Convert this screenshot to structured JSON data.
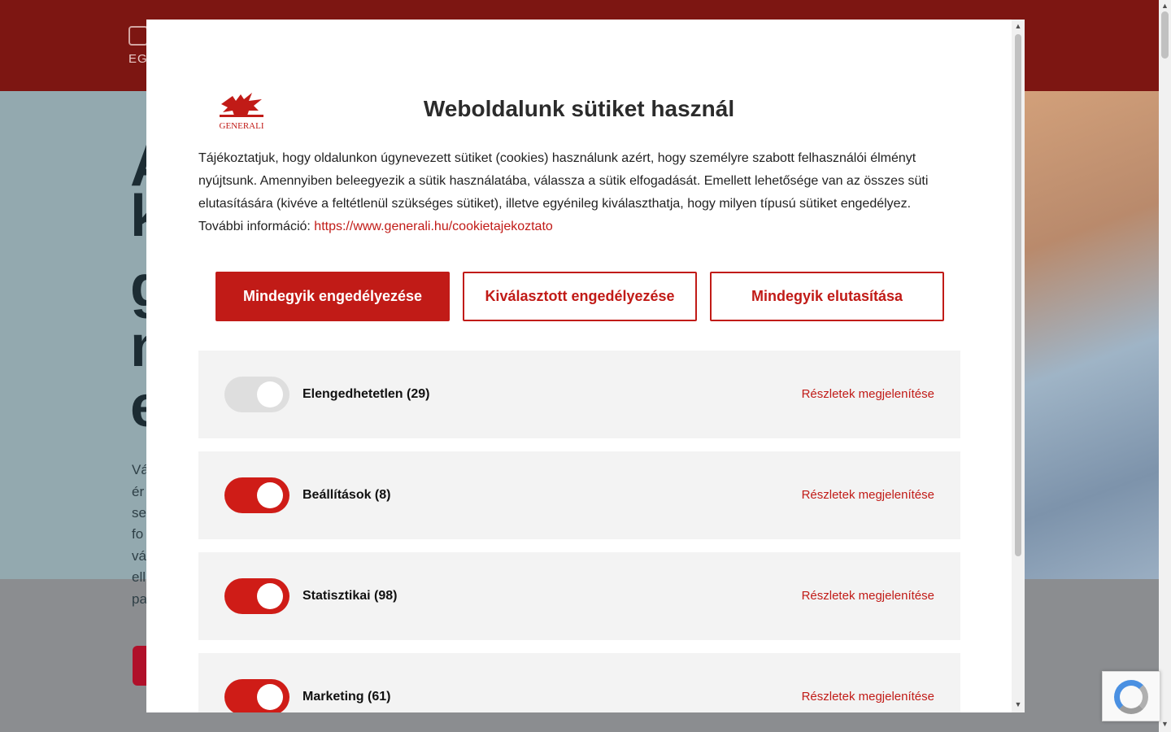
{
  "background": {
    "logo_text": "EGI",
    "hero_letters": [
      "A",
      "k",
      "g",
      "n",
      "e"
    ],
    "hero_lines": [
      "Vá",
      "ér",
      "se",
      "fo",
      "vá",
      "ell",
      "pa"
    ]
  },
  "modal": {
    "title": "Weboldalunk sütiket használ",
    "intro_text": "Tájékoztatjuk, hogy oldalunkon úgynevezett sütiket (cookies) használunk azért, hogy személyre szabott felhasználói élményt nyújtsunk. Amennyiben beleegyezik a sütik használatába, válassza a sütik elfogadását. Emellett lehetősége van az összes süti elutasítására (kivéve a feltétlenül szükséges sütiket), illetve egyénileg kiválaszthatja, hogy milyen típusú sütiket engedélyez. További információ: ",
    "intro_link": "https://www.generali.hu/cookietajekoztato",
    "logo_text": "GENERALI",
    "buttons": {
      "allow_all": "Mindegyik engedélyezése",
      "allow_selected": "Kiválasztott engedélyezése",
      "reject_all": "Mindegyik elutasítása"
    },
    "categories": [
      {
        "label": "Elengedhetetlen (29)",
        "details": "Részletek megjelenítése",
        "enabled": true,
        "locked": true
      },
      {
        "label": "Beállítások (8)",
        "details": "Részletek megjelenítése",
        "enabled": true,
        "locked": false
      },
      {
        "label": "Statisztikai (98)",
        "details": "Részletek megjelenítése",
        "enabled": true,
        "locked": false
      },
      {
        "label": "Marketing (61)",
        "details": "Részletek megjelenítése",
        "enabled": true,
        "locked": false
      }
    ]
  },
  "colors": {
    "brand_red": "#c11b17",
    "header_red": "#7d1612",
    "panel_gray": "#f3f3f3"
  }
}
